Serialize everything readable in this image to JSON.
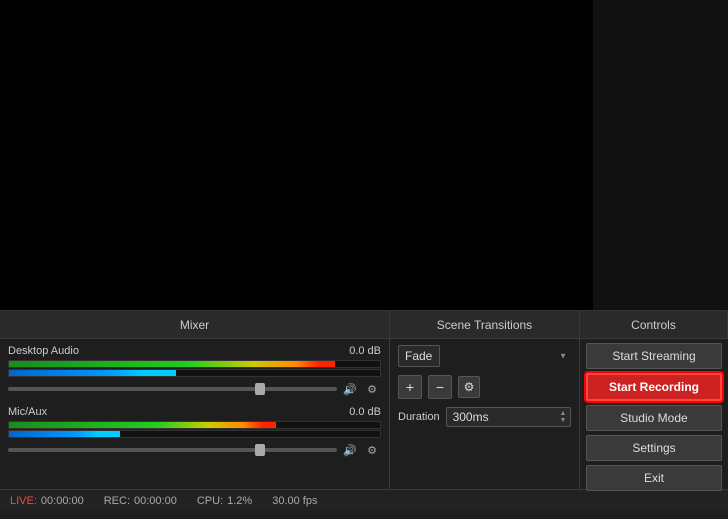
{
  "preview": {
    "main_bg": "#000000",
    "side_bg": "#111111"
  },
  "sections": {
    "mixer_label": "Mixer",
    "transitions_label": "Scene Transitions",
    "controls_label": "Controls"
  },
  "mixer": {
    "desktop_audio": {
      "name": "Desktop Audio",
      "db": "0.0 dB",
      "meter1_width": "88%",
      "meter2_width": "45%"
    },
    "mic_aux": {
      "name": "Mic/Aux",
      "db": "0.0 dB",
      "meter1_width": "72%",
      "meter2_width": "30%"
    }
  },
  "transitions": {
    "fade_value": "Fade",
    "add_label": "+",
    "remove_label": "−",
    "settings_icon": "⚙",
    "duration_label": "Duration",
    "duration_value": "300ms"
  },
  "controls": {
    "start_streaming_label": "Start Streaming",
    "start_recording_label": "Start Recording",
    "studio_mode_label": "Studio Mode",
    "settings_label": "Settings",
    "exit_label": "Exit"
  },
  "statusbar": {
    "live_label": "LIVE:",
    "live_time": "00:00:00",
    "rec_label": "REC:",
    "rec_time": "00:00:00",
    "cpu_label": "CPU:",
    "cpu_value": "1.2%",
    "fps_value": "30.00 fps"
  }
}
